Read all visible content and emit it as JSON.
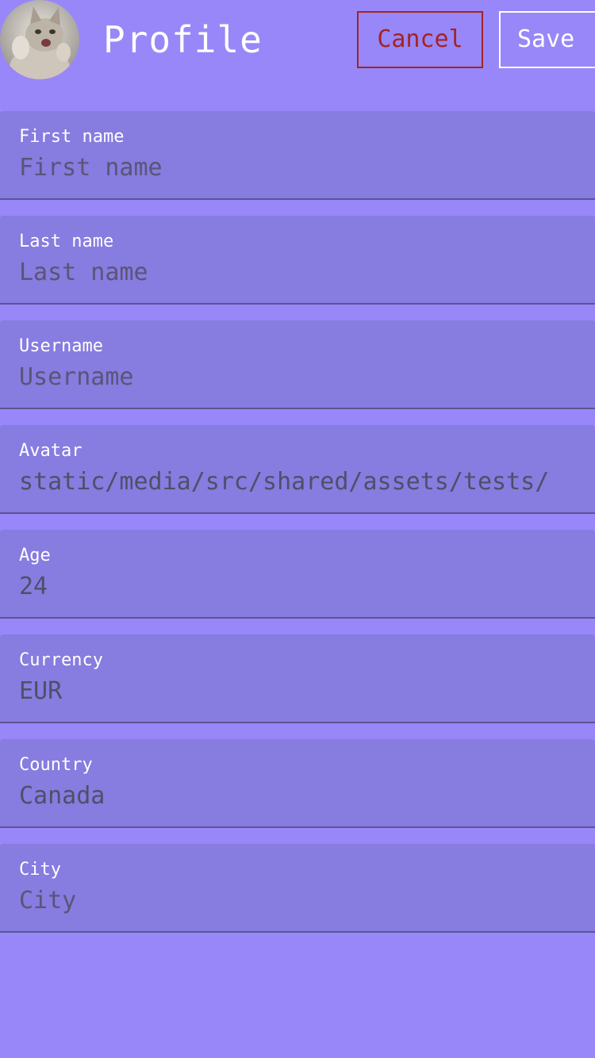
{
  "header": {
    "avatar_icon": "cat-avatar-icon",
    "title": "Profile",
    "cancel_label": "Cancel",
    "save_label": "Save"
  },
  "colors": {
    "background": "#9887f8",
    "field_background": "#877cdf",
    "cancel": "#a52323"
  },
  "form": {
    "fields": [
      {
        "label": "First name",
        "value": "",
        "placeholder": "First name"
      },
      {
        "label": "Last name",
        "value": "",
        "placeholder": "Last name"
      },
      {
        "label": "Username",
        "value": "",
        "placeholder": "Username"
      },
      {
        "label": "Avatar",
        "value": "static/media/src/shared/assets/tests/",
        "placeholder": ""
      },
      {
        "label": "Age",
        "value": "24",
        "placeholder": ""
      },
      {
        "label": "Currency",
        "value": "EUR",
        "placeholder": ""
      },
      {
        "label": "Country",
        "value": "Canada",
        "placeholder": ""
      },
      {
        "label": "City",
        "value": "",
        "placeholder": "City"
      }
    ]
  }
}
